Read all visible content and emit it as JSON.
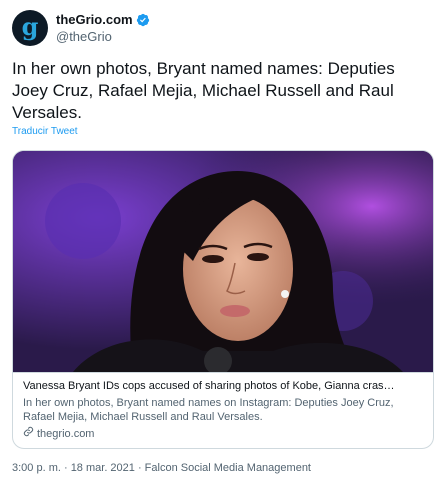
{
  "author": {
    "display_name": "theGrio.com",
    "handle": "@theGrio",
    "avatar_letter": "g",
    "avatar_color": "#0d1a26",
    "avatar_letter_color": "#2aa6dd",
    "verified_color": "#1d9bf0"
  },
  "tweet": {
    "text": "In her own photos, Bryant named names: Deputies Joey Cruz, Rafael Mejia, Michael Russell and Raul Versales.",
    "translate_label": "Traducir Tweet"
  },
  "card": {
    "title": "Vanessa Bryant IDs cops accused of sharing photos of Kobe, Gianna cras…",
    "description": "In her own photos, Bryant named names on Instagram: Deputies Joey Cruz, Rafael Mejia, Michael Russell and Raul Versales.",
    "domain": "thegrio.com",
    "link_icon": "link-icon"
  },
  "meta": {
    "text": "3:00 p. m. · 18 mar. 2021 · Falcon Social Media Management"
  }
}
